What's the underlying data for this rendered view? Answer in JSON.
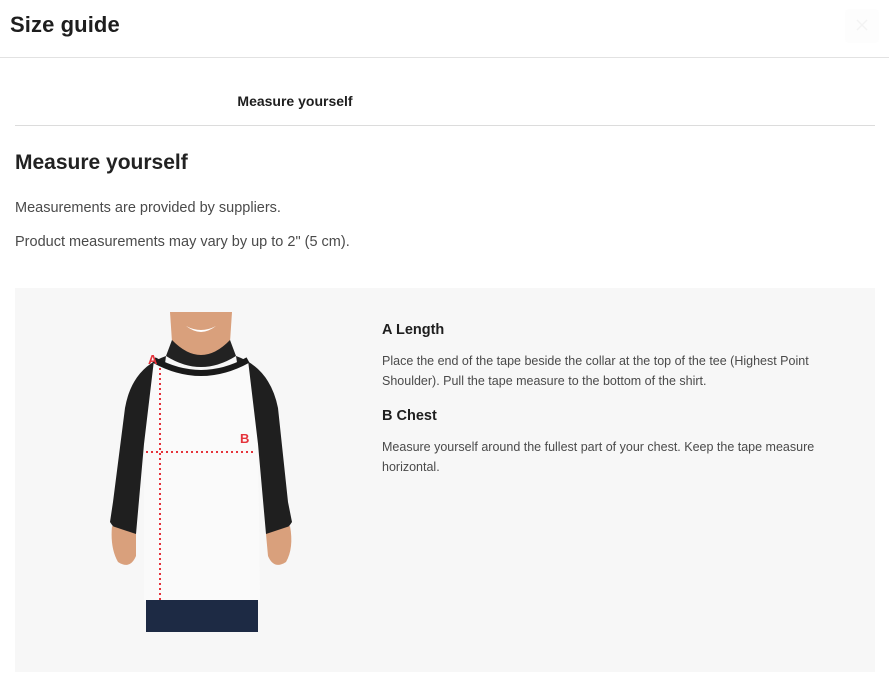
{
  "header": {
    "title": "Size guide",
    "close_icon": "close-icon"
  },
  "tabs": [
    {
      "label": "Measure yourself",
      "active": true
    }
  ],
  "section": {
    "title": "Measure yourself",
    "paragraphs": [
      "Measurements are provided by suppliers.",
      "Product measurements may vary by up to 2\" (5 cm)."
    ]
  },
  "figure": {
    "marker_a": "A",
    "marker_b": "B",
    "marker_color": "#e5333b"
  },
  "details": [
    {
      "title": "A Length",
      "text": "Place the end of the tape beside the collar at the top of the tee (Highest Point Shoulder). Pull the tape measure to the bottom of the shirt."
    },
    {
      "title": "B Chest",
      "text": "Measure yourself around the fullest part of your chest. Keep the tape measure horizontal."
    }
  ]
}
